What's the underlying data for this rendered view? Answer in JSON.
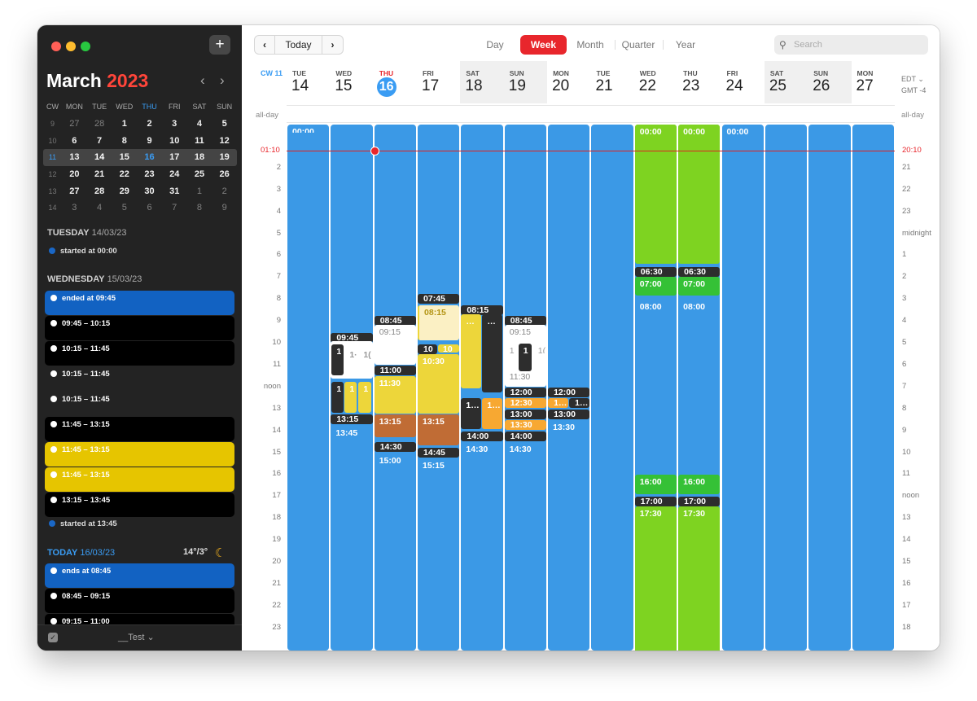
{
  "sidebar": {
    "add_label": "+",
    "month": "March",
    "year": "2023",
    "nav_prev": "‹",
    "nav_next": "›",
    "minical": {
      "headers": [
        "CW",
        "MON",
        "TUE",
        "WED",
        "THU",
        "FRI",
        "SAT",
        "SUN"
      ],
      "rows": [
        [
          "9",
          "27",
          "28",
          "1",
          "2",
          "3",
          "4",
          "5"
        ],
        [
          "10",
          "6",
          "7",
          "8",
          "9",
          "10",
          "11",
          "12"
        ],
        [
          "11",
          "13",
          "14",
          "15",
          "16",
          "17",
          "18",
          "19"
        ],
        [
          "12",
          "20",
          "21",
          "22",
          "23",
          "24",
          "25",
          "26"
        ],
        [
          "13",
          "27",
          "28",
          "29",
          "30",
          "31",
          "1",
          "2"
        ],
        [
          "14",
          "3",
          "4",
          "5",
          "6",
          "7",
          "8",
          "9"
        ]
      ]
    },
    "sections": [
      {
        "day": "TUESDAY",
        "date": "14/03/23"
      },
      {
        "day": "WEDNESDAY",
        "date": "15/03/23"
      },
      {
        "day": "TODAY",
        "date": "16/03/23"
      }
    ],
    "events": [
      {
        "label": "started at 00:00"
      },
      {
        "label": "ended at 09:45"
      },
      {
        "label": "09:45 – 10:15"
      },
      {
        "label": "10:15 – 11:45"
      },
      {
        "label": "10:15 – 11:45"
      },
      {
        "label": "10:15 – 11:45"
      },
      {
        "label": "11:45 – 13:15"
      },
      {
        "label": "11:45 – 13:15"
      },
      {
        "label": "11:45 – 13:15"
      },
      {
        "label": "13:15 – 13:45"
      },
      {
        "label": "started at 13:45"
      },
      {
        "label": "ends at 08:45"
      },
      {
        "label": "08:45 – 09:15"
      },
      {
        "label": "09:15 – 11:00"
      }
    ],
    "weather": "14°/3°",
    "moon_icon": "moon-icon",
    "footer_label": "__Test ⌄"
  },
  "toolbar": {
    "prev": "‹",
    "today": "Today",
    "next": "›",
    "views": [
      "Day",
      "Week",
      "Month",
      "Quarter",
      "Year"
    ],
    "active_view": "Week",
    "search_placeholder": "Search"
  },
  "week": {
    "cw": "CW 11",
    "days": [
      {
        "dow": "TUE",
        "num": "14"
      },
      {
        "dow": "WED",
        "num": "15"
      },
      {
        "dow": "THU",
        "num": "16"
      },
      {
        "dow": "FRI",
        "num": "17"
      },
      {
        "dow": "SAT",
        "num": "18"
      },
      {
        "dow": "SUN",
        "num": "19"
      },
      {
        "dow": "MON",
        "num": "20"
      },
      {
        "dow": "TUE",
        "num": "21"
      },
      {
        "dow": "WED",
        "num": "22"
      },
      {
        "dow": "THU",
        "num": "23"
      },
      {
        "dow": "FRI",
        "num": "24"
      },
      {
        "dow": "SAT",
        "num": "25"
      },
      {
        "dow": "SUN",
        "num": "26"
      },
      {
        "dow": "MON",
        "num": "27"
      }
    ],
    "tz_primary": "EDT ⌄",
    "tz_secondary": "GMT -4",
    "allday": "all-day",
    "now_left": "01:10",
    "now_right": "20:10",
    "hours_left": [
      "2",
      "3",
      "4",
      "5",
      "6",
      "7",
      "8",
      "9",
      "10",
      "11",
      "noon",
      "13",
      "14",
      "15",
      "16",
      "17",
      "18",
      "19",
      "20",
      "21",
      "22",
      "23"
    ],
    "hours_right": [
      "21",
      "22",
      "23",
      "midnight",
      "1",
      "2",
      "3",
      "4",
      "5",
      "6",
      "7",
      "8",
      "9",
      "10",
      "11",
      "noon",
      "13",
      "14",
      "15",
      "16",
      "17",
      "18"
    ]
  },
  "events": {
    "t0000": "00:00",
    "t0630": "06:30",
    "t0700": "07:00",
    "t0800": "08:00",
    "t0745": "07:45",
    "t0815": "08:15",
    "t0845": "08:45",
    "t0915": "09:15",
    "t0945": "09:45",
    "t1000": "10",
    "t1030": "10:30",
    "t1100": "11:00",
    "t1130": "11:30",
    "t1130b": "11:30",
    "t1200": "12:00",
    "t1230": "12:30",
    "t1300": "13:00",
    "t1315": "13:15",
    "t1330": "13:30",
    "t1345": "13:45",
    "t1400": "14:00",
    "t1430": "14:30",
    "t1445": "14:45",
    "t1500": "15:00",
    "t1515": "15:15",
    "t1600": "16:00",
    "t1700": "17:00",
    "t1730": "17:30",
    "dots": "…",
    "one": "1",
    "one_dots": "1…",
    "frag_10": "10",
    "frag_1a": "1·",
    "frag_1b": "1(",
    "frag_1c": "1",
    "frag_1d": "1("
  },
  "colors": {
    "blue": "#3b99e6",
    "green": "#7ed321",
    "darkgreen": "#35c136",
    "yellow": "#edd63a",
    "orange": "#f7a832",
    "brown": "#c06c35",
    "dark": "#2d2d2d",
    "accent": "#e8262c",
    "today_blue": "#3a9cf3"
  }
}
